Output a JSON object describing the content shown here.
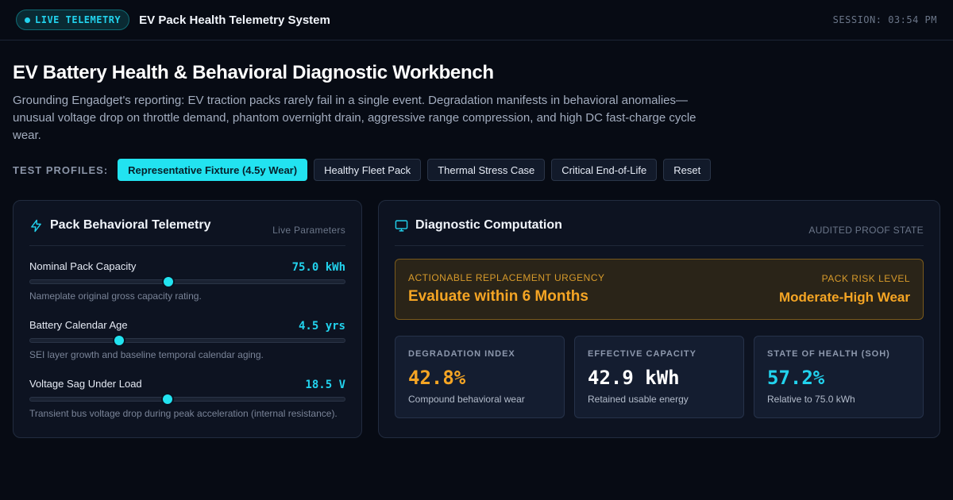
{
  "header": {
    "live_badge": "LIVE TELEMETRY",
    "system_title": "EV Pack Health Telemetry System",
    "session": "SESSION: 03:54 PM"
  },
  "page": {
    "title": "EV Battery Health & Behavioral Diagnostic Workbench",
    "description": "Grounding Engadget's reporting: EV traction packs rarely fail in a single event. Degradation manifests in behavioral anomalies—unusual voltage drop on throttle demand, phantom overnight drain, aggressive range compression, and high DC fast-charge cycle wear."
  },
  "profiles": {
    "label": "TEST PROFILES:",
    "buttons": [
      {
        "label": "Representative Fixture (4.5y Wear)",
        "active": true
      },
      {
        "label": "Healthy Fleet Pack",
        "active": false
      },
      {
        "label": "Thermal Stress Case",
        "active": false
      },
      {
        "label": "Critical End-of-Life",
        "active": false
      },
      {
        "label": "Reset",
        "active": false
      }
    ]
  },
  "telemetry": {
    "title": "Pack Behavioral Telemetry",
    "subtitle": "Live Parameters",
    "icon": "lightning-icon",
    "params": [
      {
        "label": "Nominal Pack Capacity",
        "value": "75.0 kWh",
        "level": 0.44,
        "desc": "Nameplate original gross capacity rating."
      },
      {
        "label": "Battery Calendar Age",
        "value": "4.5 yrs",
        "level": 0.285,
        "desc": "SEI layer growth and baseline temporal calendar aging."
      },
      {
        "label": "Voltage Sag Under Load",
        "value": "18.5 V",
        "level": 0.436,
        "desc": "Transient bus voltage drop during peak acceleration (internal resistance)."
      }
    ]
  },
  "diagnostic": {
    "title": "Diagnostic Computation",
    "subtitle": "AUDITED PROOF STATE",
    "icon": "monitor-icon",
    "urgency_label": "ACTIONABLE REPLACEMENT URGENCY",
    "urgency_value": "Evaluate within 6 Months",
    "risk_label": "PACK RISK LEVEL",
    "risk_value": "Moderate-High Wear",
    "metrics": [
      {
        "label": "DEGRADATION INDEX",
        "value": "42.8%",
        "desc": "Compound behavioral wear",
        "color": "#f5a524"
      },
      {
        "label": "EFFECTIVE CAPACITY",
        "value": "42.9 kWh",
        "desc": "Retained usable energy",
        "color": "#ffffff"
      },
      {
        "label": "STATE OF HEALTH (SOH)",
        "value": "57.2%",
        "desc": "Relative to 75.0 kWh",
        "color": "#22d3ee"
      }
    ]
  }
}
